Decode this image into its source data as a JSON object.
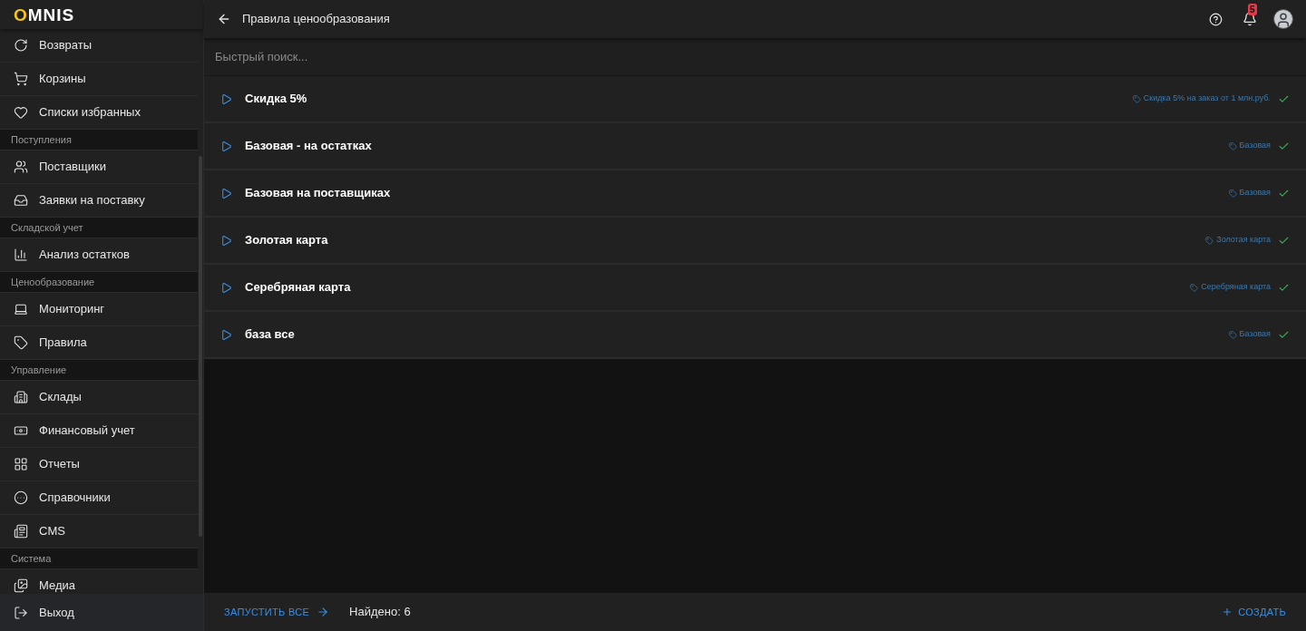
{
  "logo": "OMNIS",
  "sidebar": {
    "groups": [
      {
        "items": [
          {
            "label": "Возвраты"
          },
          {
            "label": "Корзины"
          },
          {
            "label": "Списки избранных"
          }
        ]
      },
      {
        "header": "Поступления",
        "items": [
          {
            "label": "Поставщики"
          },
          {
            "label": "Заявки на поставку"
          }
        ]
      },
      {
        "header": "Складской учет",
        "items": [
          {
            "label": "Анализ остатков"
          }
        ]
      },
      {
        "header": "Ценообразование",
        "items": [
          {
            "label": "Мониторинг"
          },
          {
            "label": "Правила"
          }
        ]
      },
      {
        "header": "Управление",
        "items": [
          {
            "label": "Склады"
          },
          {
            "label": "Финансовый учет"
          },
          {
            "label": "Отчеты"
          },
          {
            "label": "Справочники"
          },
          {
            "label": "CMS"
          }
        ]
      },
      {
        "header": "Система",
        "items": [
          {
            "label": "Медиа"
          }
        ]
      }
    ],
    "logout": "Выход"
  },
  "header": {
    "title": "Правила ценообразования",
    "notifications": "5"
  },
  "search": {
    "placeholder": "Быстрый поиск..."
  },
  "rules": [
    {
      "name": "Скидка 5%",
      "tag": "Скидка 5% на заказ от 1 млн.руб.",
      "active": true
    },
    {
      "name": "Базовая - на остатках",
      "tag": "Базовая",
      "active": true
    },
    {
      "name": "Базовая на поставщиках",
      "tag": "Базовая",
      "active": true
    },
    {
      "name": "Золотая карта",
      "tag": "Золотая карта",
      "active": true
    },
    {
      "name": "Серебряная карта",
      "tag": "Серебряная карта",
      "active": true
    },
    {
      "name": "база все",
      "tag": "Базовая",
      "active": true
    }
  ],
  "footer": {
    "run_all": "ЗАПУСТИТЬ ВСЕ",
    "found": "Найдено: 6",
    "create": "СОЗДАТЬ"
  }
}
